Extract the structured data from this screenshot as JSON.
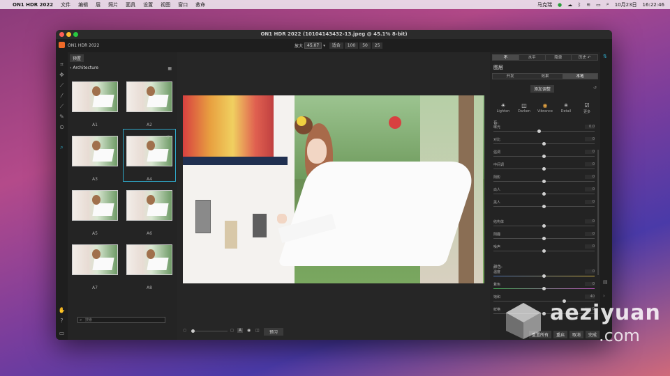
{
  "menubar": {
    "items": [
      "ON1 HDR 2022",
      "文件",
      "编辑",
      "层",
      "照片",
      "面具",
      "设置",
      "视图",
      "窗口",
      "救命"
    ],
    "right": {
      "user": "马克瑞",
      "date": "10月23日",
      "time": "16:22:46"
    }
  },
  "window": {
    "title": "ON1 HDR 2022 (10104143432-13.jpeg @ 45.1% 8-bit)",
    "app_name": "ON1 HDR 2022"
  },
  "zoom": {
    "label": "放大",
    "value": "45.07",
    "fit": "适合",
    "options": [
      "100",
      "50",
      "25"
    ]
  },
  "browser": {
    "preset_button": "预置",
    "folder": "Architecture",
    "search_placeholder": "搜索",
    "thumbs": [
      "A1",
      "A2",
      "A3",
      "A4",
      "A5",
      "A6",
      "A7",
      "A8"
    ],
    "selected": "A4"
  },
  "canvas": {
    "preview_button": "预习"
  },
  "right": {
    "view_tabs": [
      "不",
      "水平",
      "隐患",
      "历史"
    ],
    "layers_title": "图层",
    "mode_tabs": [
      "开发",
      "效果",
      "本地"
    ],
    "active_mode": "本地",
    "add_adjustment": "添加调整",
    "presets": [
      {
        "icon": "sun-icon",
        "label": "Lighten"
      },
      {
        "icon": "darken-icon",
        "label": "Darken"
      },
      {
        "icon": "vibrance-icon",
        "label": "Vibrance"
      },
      {
        "icon": "detail-icon",
        "label": "Detail"
      },
      {
        "icon": "more-icon",
        "label": "更多"
      }
    ],
    "sections": {
      "tone": "音:",
      "color": "颜色:"
    },
    "tone_sliders": [
      {
        "name": "曝光",
        "value": "0.0"
      },
      {
        "name": "对比",
        "value": "0"
      },
      {
        "name": "强调",
        "value": "0"
      },
      {
        "name": "中间调",
        "value": "0"
      },
      {
        "name": "阴影",
        "value": "0"
      },
      {
        "name": "白人",
        "value": "0"
      },
      {
        "name": "黑人",
        "value": "0"
      }
    ],
    "detail_sliders": [
      {
        "name": "结构体",
        "value": "0"
      },
      {
        "name": "阴霾",
        "value": "0"
      },
      {
        "name": "噪声",
        "value": "0"
      }
    ],
    "color_sliders": [
      {
        "name": "温度",
        "value": "0"
      },
      {
        "name": "着色",
        "value": "0"
      },
      {
        "name": "饱和",
        "value": "40"
      },
      {
        "name": "鲜艳",
        "value": "0"
      }
    ],
    "buttons": [
      "重置所有",
      "重启",
      "取消",
      "完成"
    ]
  },
  "watermark": {
    "line1": "aeziyuan",
    "line2": ".com"
  },
  "colors": {
    "accent": "#2fa8c8",
    "app_logo": "#f06a28",
    "close": "#ff5f57",
    "minimize": "#febc2e",
    "zoom": "#28c840"
  }
}
